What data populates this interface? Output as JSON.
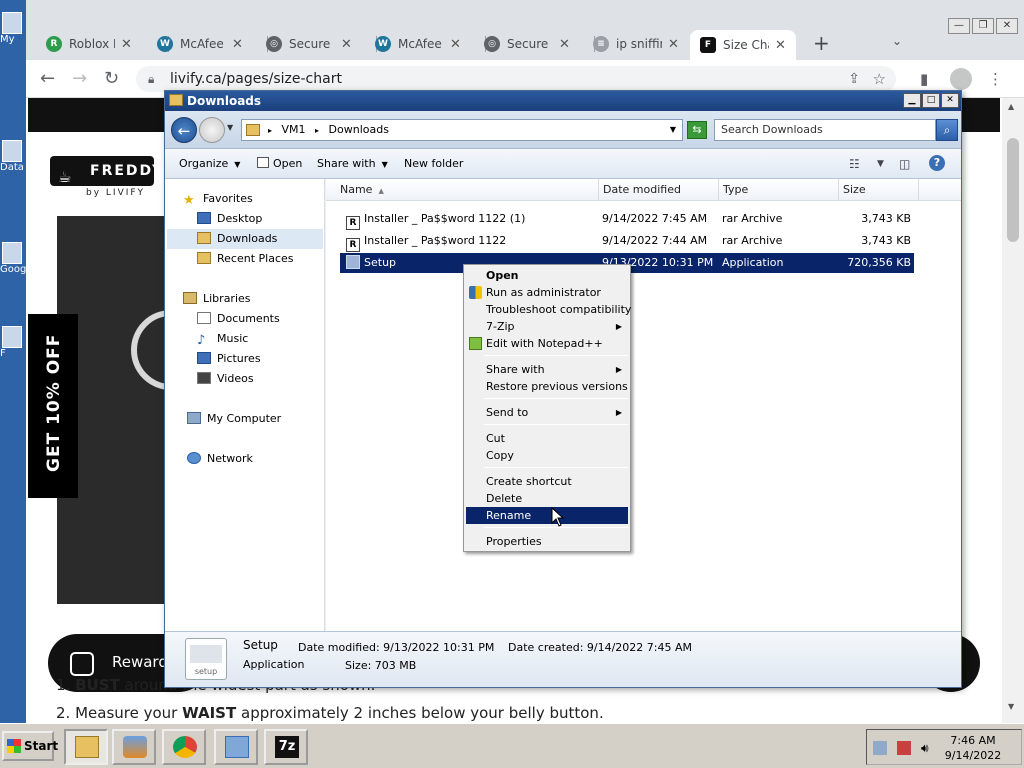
{
  "desktop": {
    "icons": [
      {
        "label": "My"
      },
      {
        "label": "Data"
      },
      {
        "label": "Goog"
      },
      {
        "label": "F"
      }
    ]
  },
  "browser": {
    "tabs": [
      {
        "label": "Roblox I",
        "fav_color": "#2e9c4d",
        "fav_glyph": "R"
      },
      {
        "label": "McAfee",
        "fav_color": "#21759b",
        "fav_glyph": "W"
      },
      {
        "label": "Secure D",
        "fav_color": "#5f6368",
        "fav_glyph": "◎"
      },
      {
        "label": "McAfee",
        "fav_color": "#21759b",
        "fav_glyph": "W"
      },
      {
        "label": "Secure D",
        "fav_color": "#5f6368",
        "fav_glyph": "◎"
      },
      {
        "label": "ip sniffin",
        "fav_color": "#9aa0a6",
        "fav_glyph": "≡"
      },
      {
        "label": "Size Cha",
        "fav_color": "#111111",
        "fav_glyph": "F"
      }
    ],
    "address": "livify.ca/pages/size-chart"
  },
  "page": {
    "logo_brand": "FREDDY",
    "logo_sub": "by LIVIFY",
    "discount": "GET 10% OFF",
    "rewards": "Reward",
    "line1_prefix": "1.",
    "line1_bold": "BUST",
    "line1_rest": "around the widest part as shown.",
    "line2_prefix": "2. Measure your",
    "line2_bold": "WAIST",
    "line2_rest": "approximately 2 inches below your belly button."
  },
  "explorer": {
    "title": "Downloads",
    "breadcrumb": [
      "VM1",
      "Downloads"
    ],
    "search_placeholder": "Search Downloads",
    "commands": {
      "organize": "Organize",
      "open": "Open",
      "share_with": "Share with",
      "new_folder": "New folder"
    },
    "nav": {
      "favorites": "Favorites",
      "desktop": "Desktop",
      "downloads": "Downloads",
      "recent": "Recent Places",
      "libraries": "Libraries",
      "documents": "Documents",
      "music": "Music",
      "pictures": "Pictures",
      "videos": "Videos",
      "computer": "My Computer",
      "network": "Network"
    },
    "columns": {
      "name": "Name",
      "date": "Date modified",
      "type": "Type",
      "size": "Size"
    },
    "files": [
      {
        "name": "Installer _ Pa$$word 1122 (1)",
        "date": "9/14/2022 7:45 AM",
        "type": "rar Archive",
        "size": "3,743 KB"
      },
      {
        "name": "Installer _ Pa$$word 1122",
        "date": "9/14/2022 7:44 AM",
        "type": "rar Archive",
        "size": "3,743 KB"
      },
      {
        "name": "Setup",
        "date": "9/13/2022 10:31 PM",
        "type": "Application",
        "size": "720,356 KB"
      }
    ],
    "details": {
      "name": "Setup",
      "kind": "Application",
      "modified": "Date modified: 9/13/2022 10:31 PM",
      "created": "Date created: 9/14/2022 7:45 AM",
      "size": "Size: 703 MB",
      "icon_label": "setup"
    }
  },
  "context_menu": {
    "open": "Open",
    "run_admin": "Run as administrator",
    "troubleshoot": "Troubleshoot compatibility",
    "seven_zip": "7-Zip",
    "notepad": "Edit with Notepad++",
    "share_with": "Share with",
    "restore": "Restore previous versions",
    "send_to": "Send to",
    "cut": "Cut",
    "copy": "Copy",
    "create_shortcut": "Create shortcut",
    "delete": "Delete",
    "rename": "Rename",
    "properties": "Properties"
  },
  "taskbar": {
    "start": "Start",
    "time": "7:46 AM",
    "date": "9/14/2022"
  }
}
